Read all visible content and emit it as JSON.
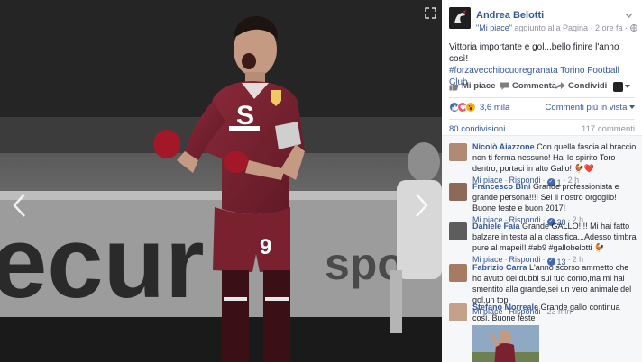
{
  "post": {
    "author": "Andrea Belotti",
    "subline_link": "\"Mi piace\"",
    "subline_text": " aggiunto alla Pagina · 2 ore fa · ",
    "text_plain": "Vittoria importante e gol...bello finire l'anno così!",
    "text_hashtag": "#forzavecchiocuoregranata Torino Football Club"
  },
  "actions": {
    "like": "Mi piace",
    "comment": "Commenta",
    "share": "Condividi"
  },
  "stats": {
    "reactions_count": "3,6 mila",
    "comment_order": "Commenti più in vista",
    "shares": "80 condivisioni",
    "comments_total": "117 commenti"
  },
  "comments": [
    {
      "name": "Nicolò Aiazzone",
      "text": " Con quella fascia al braccio non ti ferma nessuno! Hai lo spirito Toro dentro, portaci in alto Gallo! 🐓❤️",
      "like": "Mi piace",
      "reply": "Rispondi",
      "likes": "1",
      "time": "2 h"
    },
    {
      "name": "Francesco Bini",
      "text": " Grande professionista e grande persona!!!! Sei il nostro orgoglio! Buone feste e buon 2017!",
      "like": "Mi piace",
      "reply": "Rispondi",
      "likes": "28",
      "time": "2 h"
    },
    {
      "name": "Daniele Faia",
      "text": " Grande GALLO!!!! Mi hai fatto balzare in testa alla classifica...Adesso timbra pure al mapei!! #ab9 #gallobelotti 🐓",
      "like": "Mi piace",
      "reply": "Rispondi",
      "likes": "13",
      "time": "2 h"
    },
    {
      "name": "Fabrizio Carra",
      "text": " L'anno scorso ammetto che ho avuto dei dubbi sul tuo conto,ma mi hai smentito alla grande,sei un vero animale del gol,un top",
      "like": "Mi piace",
      "reply": "Rispondi",
      "likes": "",
      "time": "23 min"
    },
    {
      "name": "Stefano Morreale",
      "text": " Grande gallo continua così. Buone feste",
      "like": "",
      "reply": "",
      "likes": "",
      "time": ""
    }
  ],
  "photo": {
    "jersey_number": "9",
    "board_text": "ecur",
    "board_text2": "spor"
  },
  "icons": {
    "prev": "chevron-left-icon",
    "next": "chevron-right-icon",
    "expand": "expand-icon",
    "like": "thumbs-up-icon",
    "comment": "speech-bubble-icon",
    "share": "share-arrow-icon",
    "menu": "chevron-down-icon"
  },
  "colors": {
    "link": "#365899",
    "jersey": "#7a2130",
    "like_blue": "#4267b2",
    "love_red": "#f25268",
    "wow_yellow": "#f7b125"
  }
}
